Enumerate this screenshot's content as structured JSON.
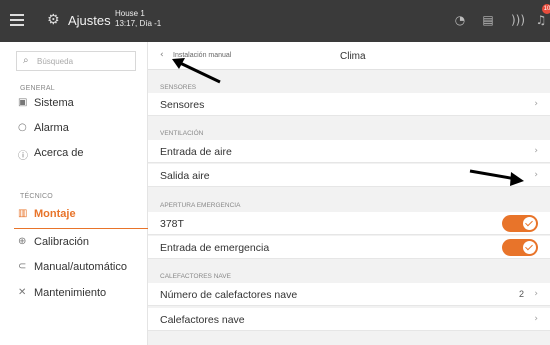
{
  "header": {
    "title": "Ajustes",
    "house_name": "House 1",
    "house_time": "13:17, Día -1",
    "notification_count": "10"
  },
  "sidebar": {
    "search_placeholder": "Búsqueda",
    "general_label": "GENERAL",
    "general_items": [
      {
        "label": "Sistema",
        "icon": "system-icon"
      },
      {
        "label": "Alarma",
        "icon": "alarm-icon"
      },
      {
        "label": "Acerca de",
        "icon": "info-icon"
      }
    ],
    "tecnico_label": "TÉCNICO",
    "tecnico_items": [
      {
        "label": "Montaje",
        "icon": "assembly-icon",
        "active": true
      },
      {
        "label": "Calibración",
        "icon": "calibration-icon"
      },
      {
        "label": "Manual/automático",
        "icon": "manual-auto-icon"
      },
      {
        "label": "Mantenimiento",
        "icon": "maintenance-icon"
      }
    ]
  },
  "main": {
    "breadcrumb": "Instalación manual",
    "title": "Clima",
    "groups": {
      "sensores": {
        "label": "SENSORES",
        "rows": [
          "Sensores"
        ]
      },
      "ventilacion": {
        "label": "VENTILACIÓN",
        "rows": [
          "Entrada de aire",
          "Salida aire"
        ]
      },
      "apertura": {
        "label": "APERTURA EMERGENCIA",
        "rows": [
          "378T",
          "Entrada de emergencia"
        ]
      },
      "calefactores": {
        "label": "CALEFACTORES NAVE",
        "rows": [
          "Número de calefactores nave",
          "Calefactores nave"
        ],
        "count_value": "2"
      }
    },
    "toggles": {
      "t378": true,
      "emergency": true
    }
  },
  "colors": {
    "accent": "#e8742a",
    "topbar": "#3a3a3a",
    "badge": "#e74c3c"
  }
}
